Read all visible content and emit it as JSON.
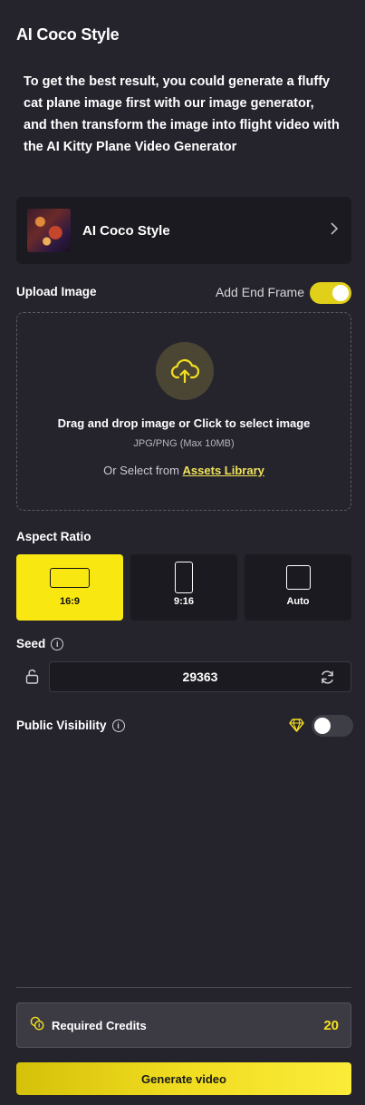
{
  "page": {
    "title": "AI Coco Style"
  },
  "intro": "To get the best result, you could generate a fluffy cat plane image first with our image generator, and then transform the image into flight video with the AI Kitty Plane Video Generator",
  "style": {
    "name": "AI Coco Style"
  },
  "upload": {
    "label": "Upload Image",
    "end_frame_label": "Add End Frame",
    "end_frame_enabled": true,
    "main_text": "Drag and drop image or Click to select image",
    "sub_text": "JPG/PNG (Max 10MB)",
    "assets_prefix": "Or Select from",
    "assets_link": "Assets Library"
  },
  "aspect_ratio": {
    "label": "Aspect Ratio",
    "options": [
      {
        "label": "16:9",
        "selected": true
      },
      {
        "label": "9:16",
        "selected": false
      },
      {
        "label": "Auto",
        "selected": false
      }
    ]
  },
  "seed": {
    "label": "Seed",
    "value": "29363"
  },
  "visibility": {
    "label": "Public Visibility",
    "enabled": false
  },
  "credits": {
    "label": "Required Credits",
    "value": "20"
  },
  "generate": {
    "label": "Generate video"
  },
  "colors": {
    "accent": "#f9e711",
    "background": "#25242d",
    "panel": "#1b1a20"
  }
}
